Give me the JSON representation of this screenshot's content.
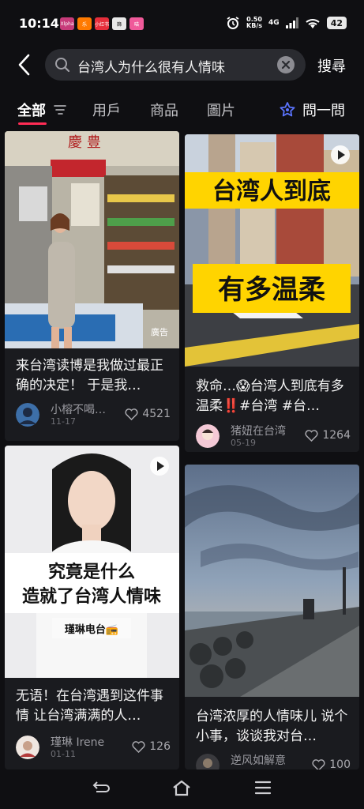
{
  "status_bar": {
    "time": "10:14",
    "apps": [
      {
        "name": "app-icon-1",
        "color": "#c73b7a",
        "text": "Xlpha"
      },
      {
        "name": "app-icon-2",
        "color": "#ff7a00",
        "text": "乐"
      },
      {
        "name": "app-icon-3",
        "color": "#e62e3b",
        "text": "小红书"
      },
      {
        "name": "app-icon-4",
        "color": "#e8e8e8",
        "text": "篩"
      },
      {
        "name": "app-icon-5",
        "color": "#f05a9a",
        "text": "喵"
      }
    ],
    "net_speed": "0.50",
    "net_unit": "KB/s",
    "network": "4G",
    "battery": "42"
  },
  "header": {
    "search_query": "台湾人为什么很有人情味",
    "search_button": "搜尋"
  },
  "tabs": {
    "items": [
      "全部",
      "用戶",
      "商品",
      "圖片"
    ],
    "active": "全部",
    "ask_label": "問一問"
  },
  "feed": {
    "cards": [
      {
        "title": "来台湾读博是我做过最正确的决定！ 于是我…",
        "author": "小榕不喝…",
        "date": "11-17",
        "likes": "4521",
        "ad_label": "廣告",
        "shop_sign": "慶 豊"
      },
      {
        "title": "救命…😱台湾人到底有多温柔‼️#台湾 #台…",
        "author": "猪妞在台湾",
        "date": "05-19",
        "likes": "1264",
        "cover_line1": "台湾人到底",
        "cover_line2": "有多温柔"
      },
      {
        "title": "无语！在台湾遇到这件事情 让台湾满满的人…",
        "author": "瑾琳 Irene",
        "date": "01-11",
        "likes": "126",
        "cover_line1": "究竟是什么",
        "cover_line2": "造就了台湾人情味",
        "cover_tag": "瑾琳电台📻"
      },
      {
        "title": "台湾浓厚的人情味儿 说个小事，谈谈我对台…",
        "author": "逆风如解意",
        "likes": "100"
      }
    ]
  },
  "colors": {
    "accent": "#ff2c55",
    "ask_icon": "#5b74ff",
    "background": "#0f0f12",
    "card": "#1a1b1f"
  }
}
